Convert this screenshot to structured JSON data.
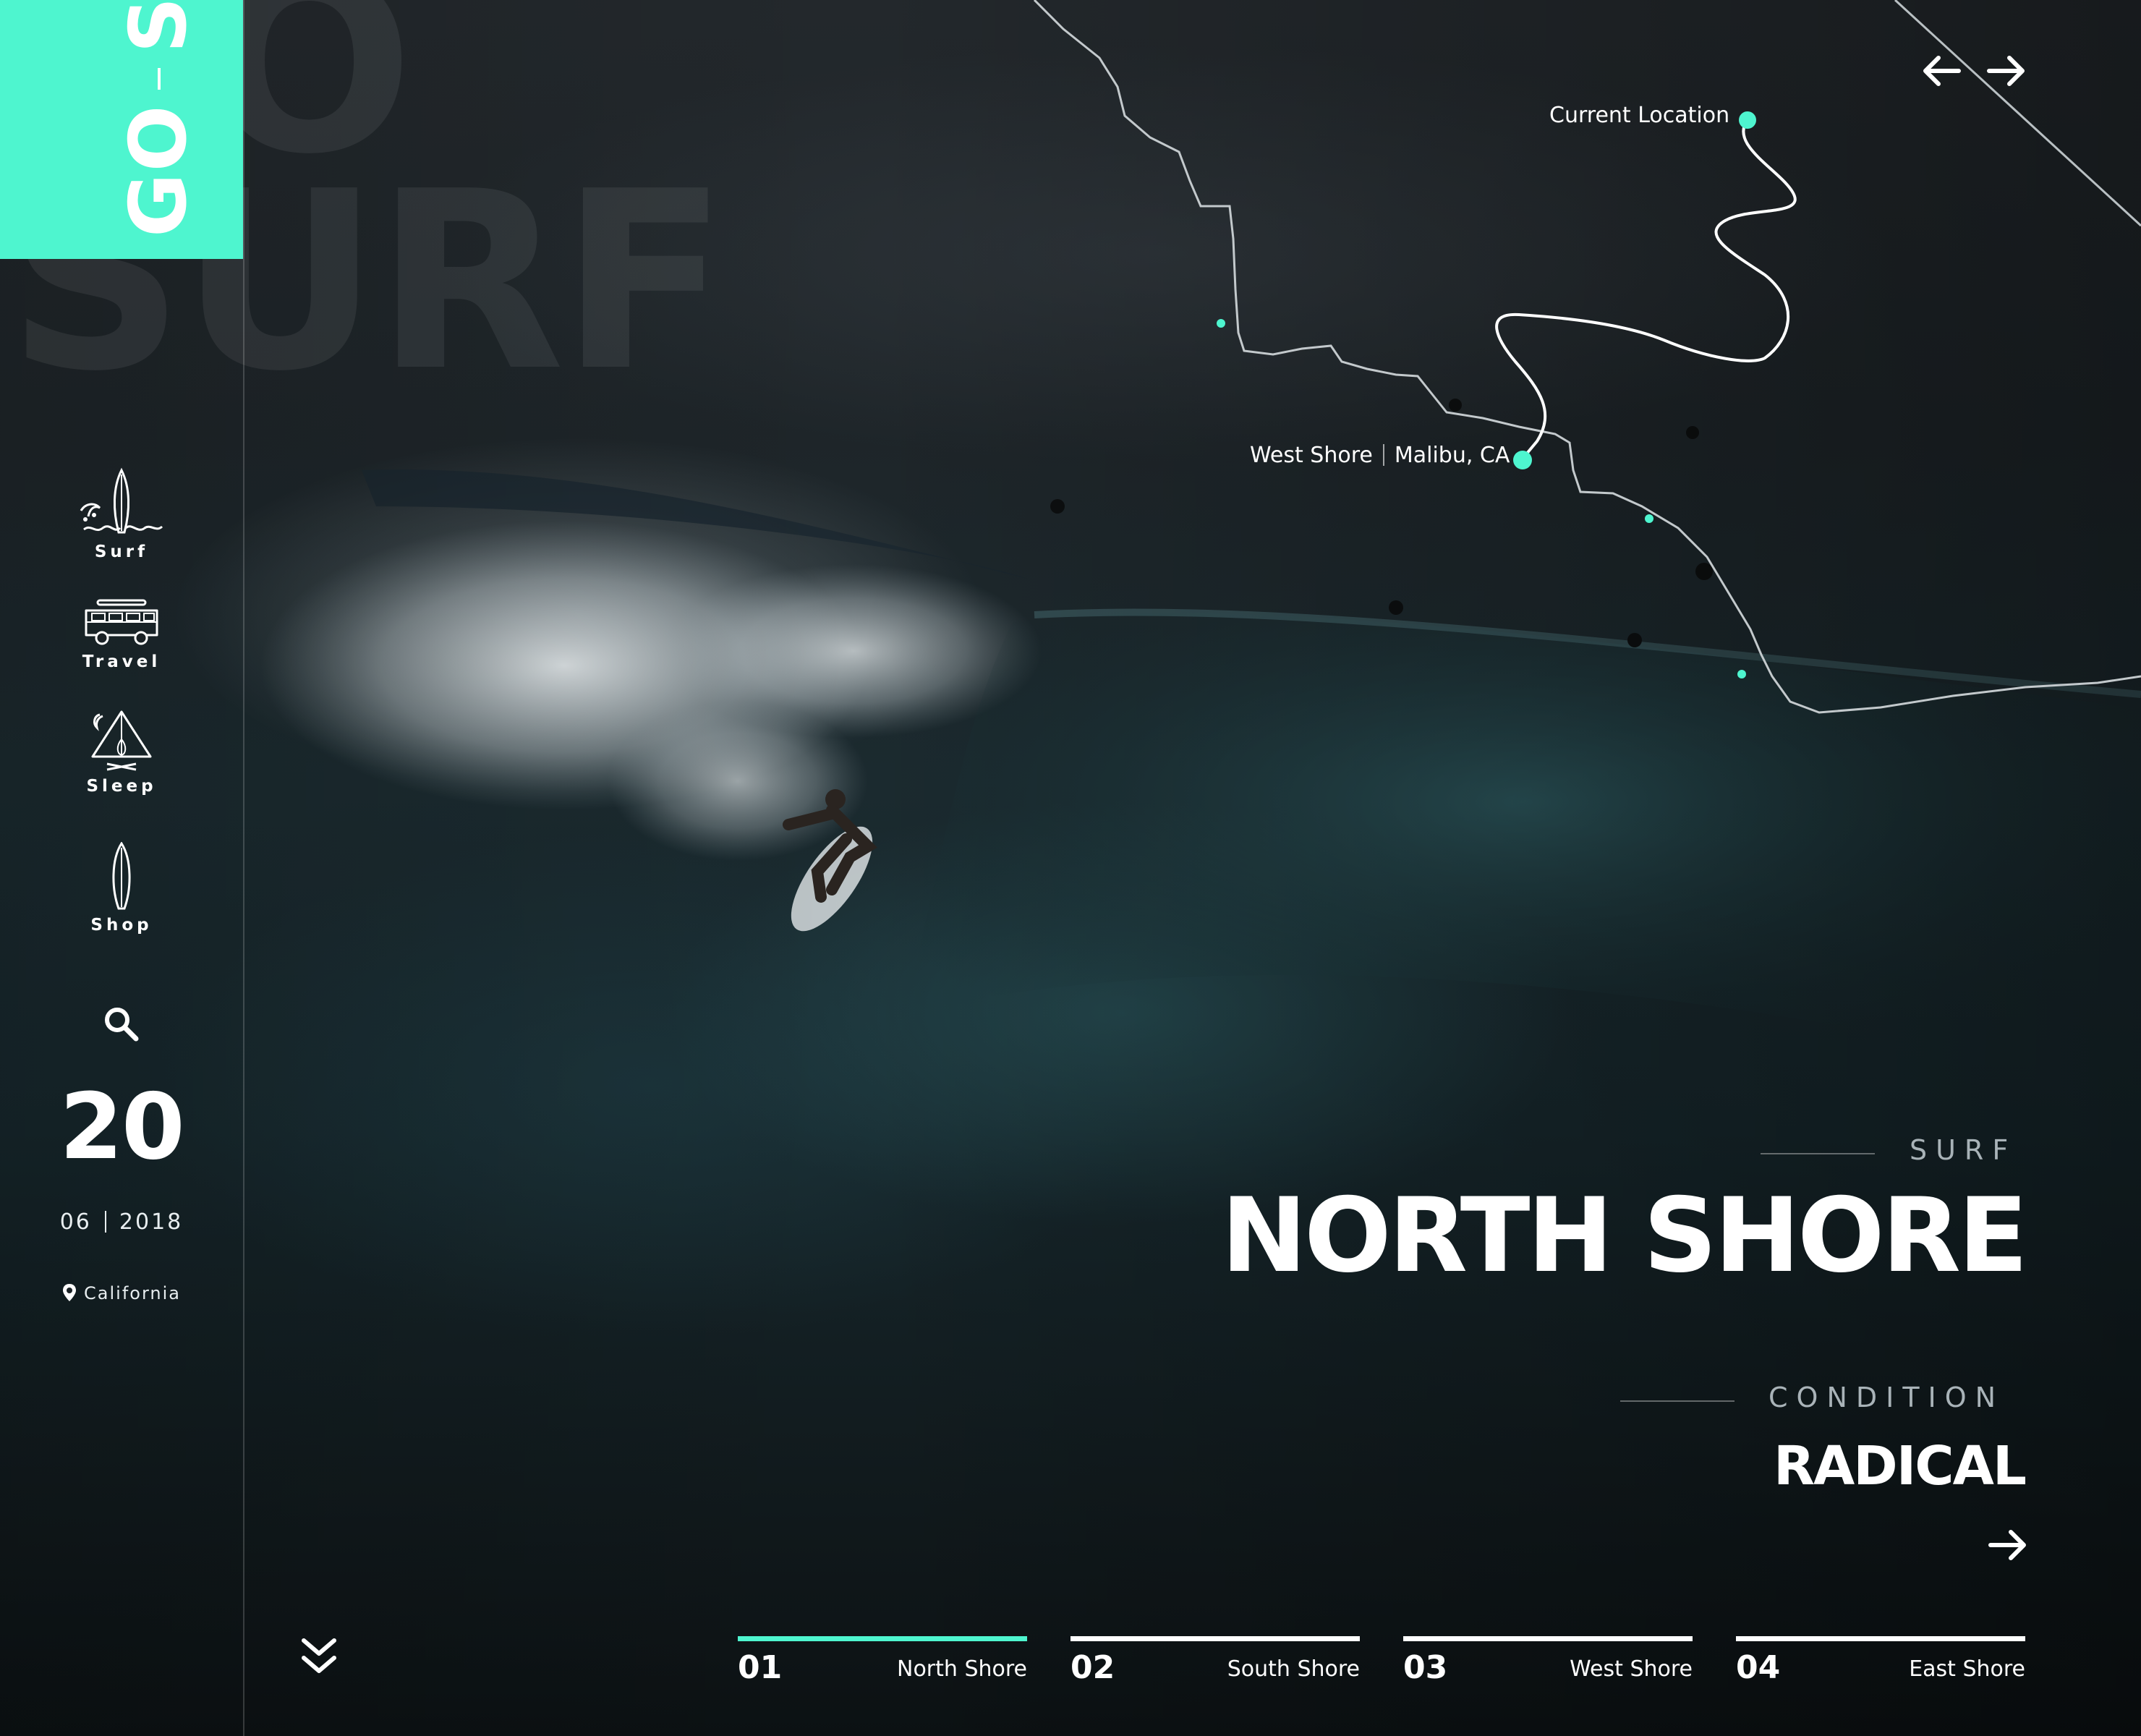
{
  "brand": {
    "go": "GO",
    "surf": "SURF",
    "accent_color": "#4ef5cf",
    "watermark_lines": [
      "GO",
      "SURF"
    ]
  },
  "sidebar": {
    "items": [
      {
        "label": "Surf",
        "icon": "surfboard-wave-icon"
      },
      {
        "label": "Travel",
        "icon": "van-icon"
      },
      {
        "label": "Sleep",
        "icon": "tent-campfire-icon"
      },
      {
        "label": "Shop",
        "icon": "surfboard-icon"
      }
    ],
    "search_icon": "search-icon"
  },
  "date": {
    "day": "20",
    "month": "06",
    "year": "2018"
  },
  "location": {
    "text": "California",
    "icon": "map-pin-icon"
  },
  "map": {
    "current_location_label": "Current Location",
    "spot_label": "West Shore",
    "spot_city": "Malibu, CA"
  },
  "hero": {
    "kicker": "SURF",
    "title": "NORTH SHORE",
    "condition_kicker": "CONDITION",
    "condition_value": "RADICAL"
  },
  "tabs": [
    {
      "num": "01",
      "label": "North Shore",
      "active": true
    },
    {
      "num": "02",
      "label": "South Shore",
      "active": false
    },
    {
      "num": "03",
      "label": "West Shore",
      "active": false
    },
    {
      "num": "04",
      "label": "East Shore",
      "active": false
    }
  ]
}
